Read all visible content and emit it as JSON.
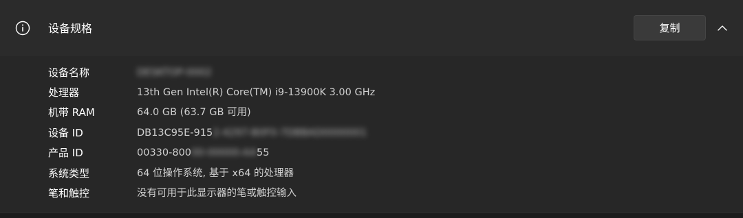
{
  "header": {
    "icon": "info-icon",
    "title": "设备规格",
    "copy_label": "复制",
    "chevron": "chevron-up-icon"
  },
  "specs": [
    {
      "label": "设备名称",
      "value_visible": "",
      "value_redacted": "DESKTOP-0002"
    },
    {
      "label": "处理器",
      "value_visible": "13th Gen Intel(R) Core(TM) i9-13900K   3.00 GHz",
      "value_redacted": ""
    },
    {
      "label": "机带 RAM",
      "value_visible": "64.0 GB (63.7 GB 可用)",
      "value_redacted": ""
    },
    {
      "label": "设备 ID",
      "value_visible": "DB13C95E-915",
      "value_redacted": "2-4297-B0F0-7DBBAD0000001",
      "value_tail": ""
    },
    {
      "label": "产品 ID",
      "value_visible": "00330-800",
      "value_redacted": "00-00000-AA",
      "value_tail": "55"
    },
    {
      "label": "系统类型",
      "value_visible": "64 位操作系统, 基于 x64 的处理器",
      "value_redacted": ""
    },
    {
      "label": "笔和触控",
      "value_visible": "没有可用于此显示器的笔或触控输入",
      "value_redacted": ""
    }
  ],
  "colors": {
    "header_bg": "#2b2b2b",
    "body_bg": "#272727",
    "button_bg": "#3a3a3a",
    "value_text": "#d0d0d0"
  }
}
